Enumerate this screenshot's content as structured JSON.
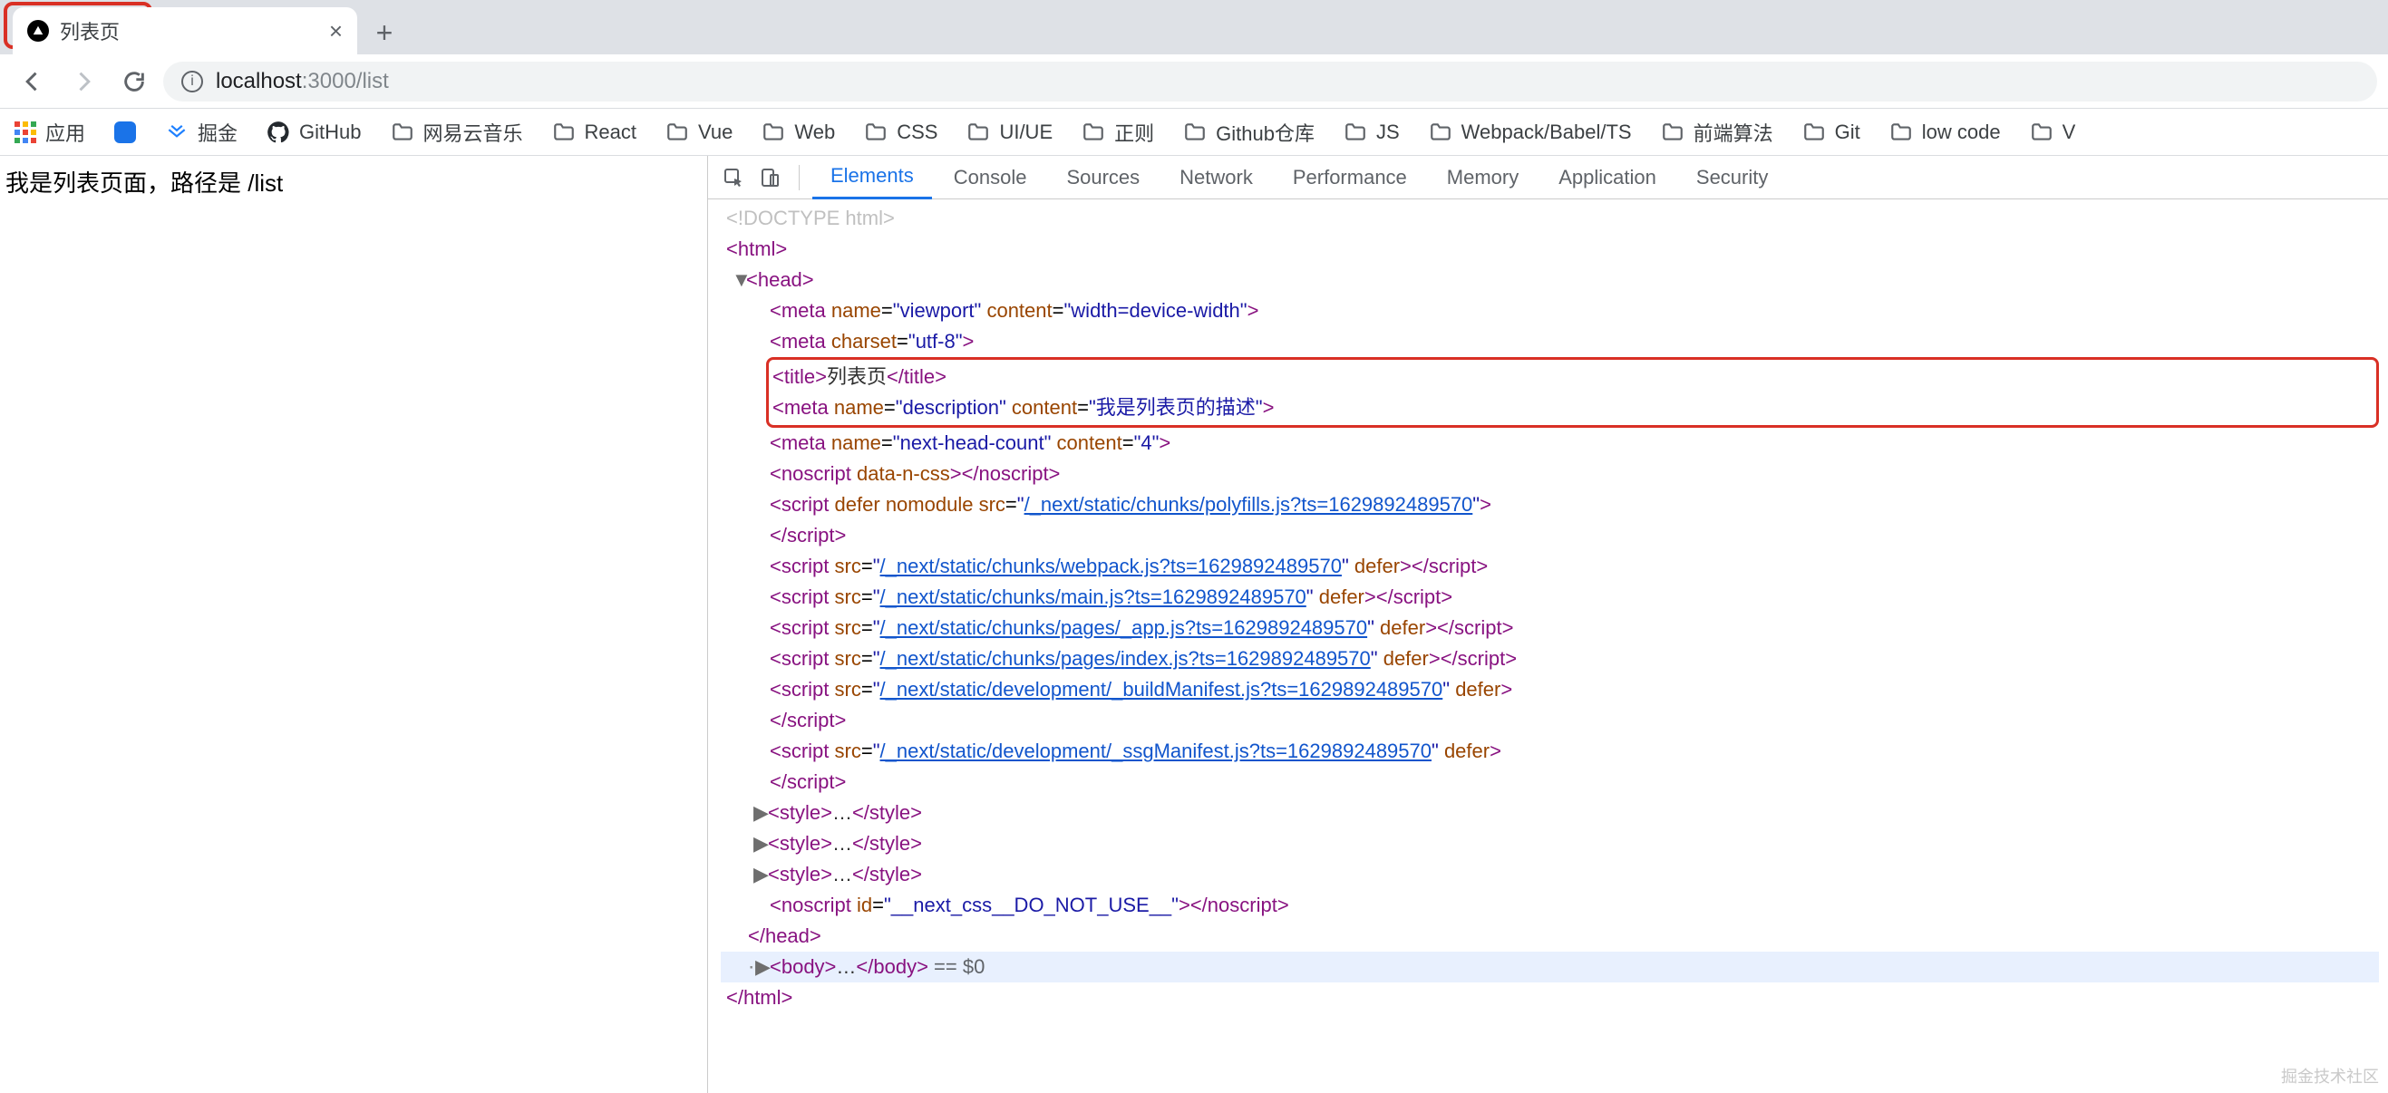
{
  "tab": {
    "title": "列表页"
  },
  "url": {
    "host": "localhost",
    "port": ":3000",
    "path": "/list"
  },
  "bookmarks": {
    "apps": "应用",
    "juejin": "掘金",
    "github": "GitHub",
    "folders": [
      "网易云音乐",
      "React",
      "Vue",
      "Web",
      "CSS",
      "UI/UE",
      "正则",
      "Github仓库",
      "JS",
      "Webpack/Babel/TS",
      "前端算法",
      "Git",
      "low code",
      "V"
    ]
  },
  "page_text": "我是列表页面，路径是 /list",
  "devtools": {
    "tabs": [
      "Elements",
      "Console",
      "Sources",
      "Network",
      "Performance",
      "Memory",
      "Application",
      "Security"
    ],
    "active": "Elements"
  },
  "dom": {
    "doctype": "<!DOCTYPE html>",
    "meta_viewport_name": "viewport",
    "meta_viewport_content": "width=device-width",
    "meta_charset": "utf-8",
    "title_text": "列表页",
    "meta_desc_name": "description",
    "meta_desc_content": "我是列表页的描述",
    "meta_head_count_name": "next-head-count",
    "meta_head_count_content": "4",
    "noscript_attr": "data-n-css",
    "scripts": [
      "/_next/static/chunks/polyfills.js?ts=1629892489570",
      "/_next/static/chunks/webpack.js?ts=1629892489570",
      "/_next/static/chunks/main.js?ts=1629892489570",
      "/_next/static/chunks/pages/_app.js?ts=1629892489570",
      "/_next/static/chunks/pages/index.js?ts=1629892489570",
      "/_next/static/development/_buildManifest.js?ts=1629892489570",
      "/_next/static/development/_ssgManifest.js?ts=1629892489570"
    ],
    "noscript_id": "__next_css__DO_NOT_USE__",
    "body_hint": "== $0"
  },
  "watermark": "掘金技术社区"
}
